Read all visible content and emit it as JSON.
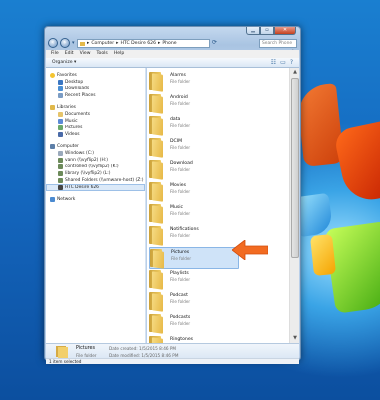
{
  "window": {
    "address": [
      "Computer",
      "HTC Desire 626",
      "Phone"
    ],
    "search_placeholder": "Search Phone"
  },
  "menu": [
    "File",
    "Edit",
    "View",
    "Tools",
    "Help"
  ],
  "toolbar": {
    "organize": "Organize ▾"
  },
  "navpane": {
    "favorites_header": "Favorites",
    "favorites": [
      "Desktop",
      "Downloads",
      "Recent Places"
    ],
    "libraries_header": "Libraries",
    "libraries": [
      "Documents",
      "Music",
      "Pictures",
      "Videos"
    ],
    "computer_header": "Computer",
    "computer": [
      "Windows (C:)",
      "vann (\\\\vyflip2) (H:)",
      "controlled (\\\\vyflip2) (K:)",
      "library (\\\\vyflip2) (L:)",
      "Shared Folders (\\\\vmware-host) (Z:)",
      "HTC Desire 626"
    ],
    "network_header": "Network"
  },
  "folders": [
    {
      "name": "Alarms",
      "type": "File folder"
    },
    {
      "name": "Android",
      "type": "File folder"
    },
    {
      "name": "data",
      "type": "File folder"
    },
    {
      "name": "DCIM",
      "type": "File folder"
    },
    {
      "name": "Download",
      "type": "File folder"
    },
    {
      "name": "Movies",
      "type": "File folder"
    },
    {
      "name": "Music",
      "type": "File folder"
    },
    {
      "name": "Notifications",
      "type": "File folder"
    },
    {
      "name": "Pictures",
      "type": "File folder"
    },
    {
      "name": "Playlists",
      "type": "File folder"
    },
    {
      "name": "Podcast",
      "type": "File folder"
    },
    {
      "name": "Podcasts",
      "type": "File folder"
    },
    {
      "name": "Ringtones",
      "type": "File folder"
    }
  ],
  "details": {
    "name": "Pictures",
    "type": "File folder",
    "created": "Date created: 1/5/2015 8:46 PM",
    "modified": "Date modified: 1/5/2015 8:46 PM"
  },
  "status": "1 item selected",
  "colors": {
    "highlight_arrow": "#f26b21",
    "selection": "#cfe3f8"
  }
}
